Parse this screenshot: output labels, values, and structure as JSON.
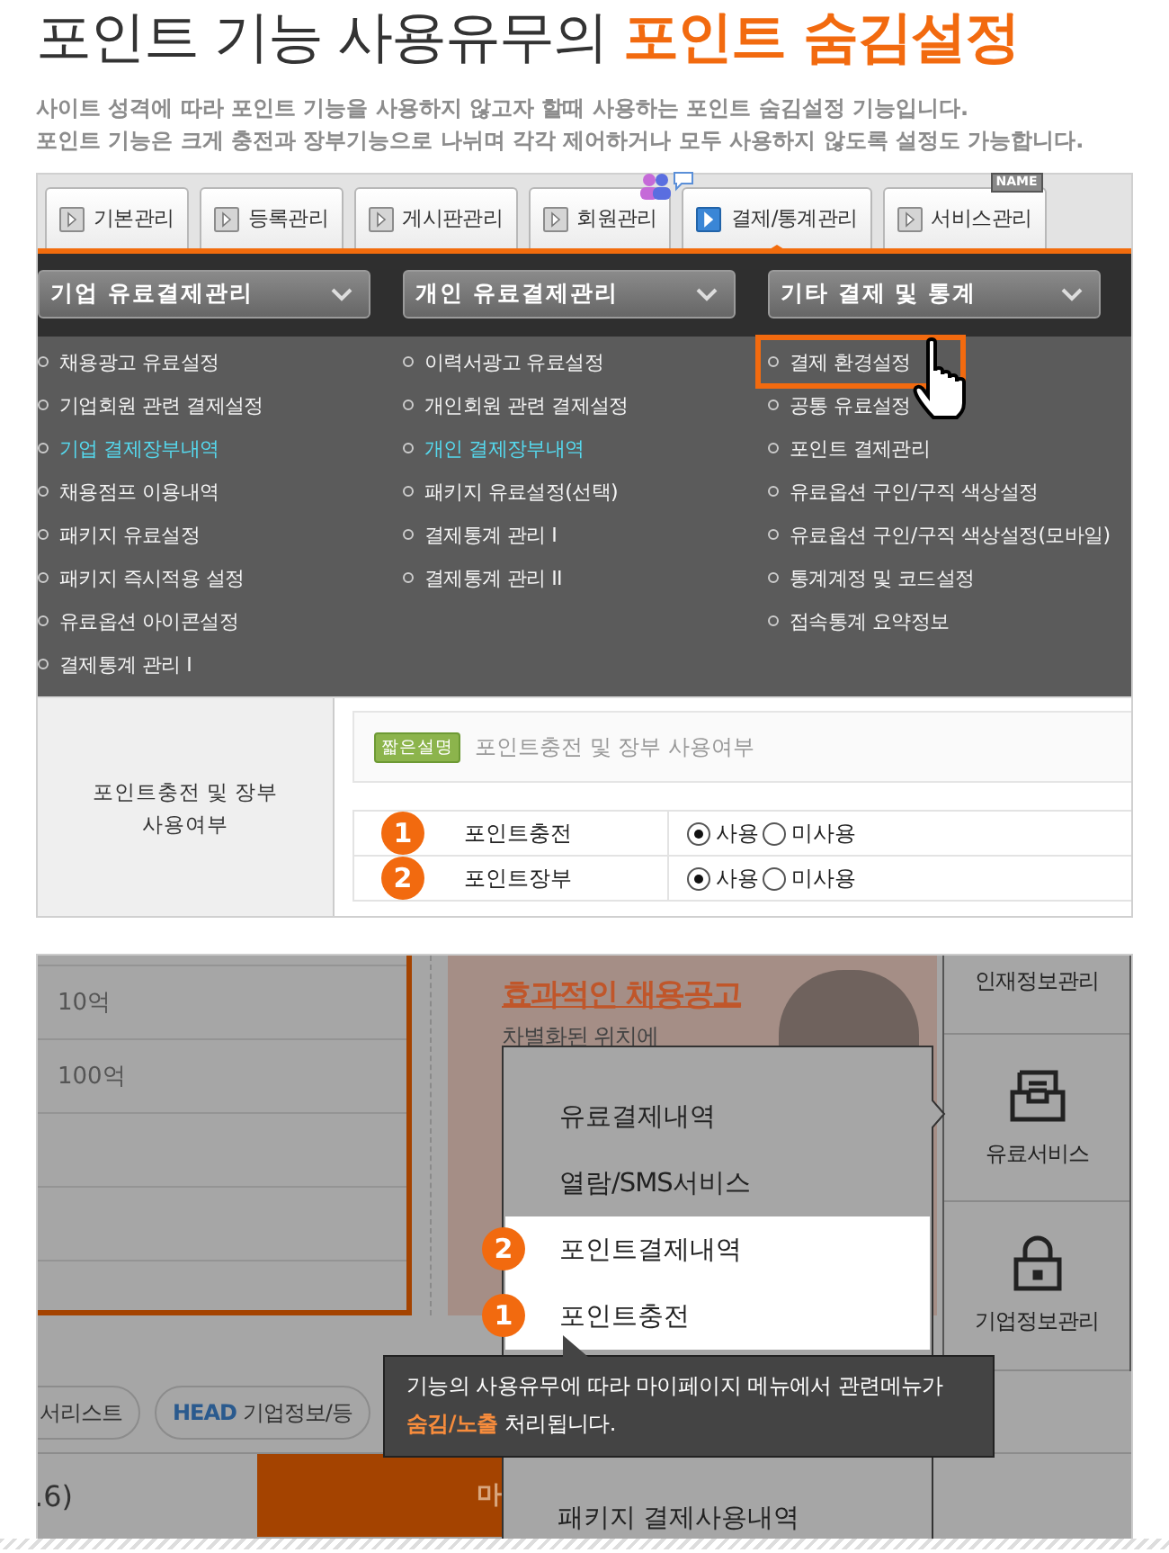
{
  "header": {
    "title": "포인트 기능 사용유무의 **포인트 숨김설정**",
    "description": [
      "사이트 성격에 따라 포인트 기능을 사용하지 않고자 할때 사용하는 포인트 숨김설정 기능입니다.",
      "포인트 기능은 크게 충전과 장부기능으로 나뉘며 각각 제어하거나 모두 사용하지 않도록 설정도 가능합니다."
    ]
  },
  "admin": {
    "tabs": [
      {
        "label": "기본관리",
        "selected": false
      },
      {
        "label": "등록관리",
        "selected": false
      },
      {
        "label": "게시판관리",
        "selected": false
      },
      {
        "label": "회원관리",
        "selected": false
      },
      {
        "label": "결제/통계관리",
        "selected": true
      },
      {
        "label": "서비스관리",
        "selected": false,
        "badge": "NAME"
      }
    ],
    "menu_columns": [
      {
        "title": "기업 유료결제관리",
        "items": [
          {
            "label": "채용광고 유료설정",
            "highlighted": false,
            "callout": false
          },
          {
            "label": "기업회원 관련 결제설정",
            "highlighted": false,
            "callout": false
          },
          {
            "label": "기업 결제장부내역",
            "highlighted": true,
            "callout": false
          },
          {
            "label": "채용점프 이용내역",
            "highlighted": false,
            "callout": false
          },
          {
            "label": "패키지 유료설정",
            "highlighted": false,
            "callout": false
          },
          {
            "label": "패키지 즉시적용 설정",
            "highlighted": false,
            "callout": false
          },
          {
            "label": "유료옵션 아이콘설정",
            "highlighted": false,
            "callout": false
          },
          {
            "label": "결제통계 관리 I",
            "highlighted": false,
            "callout": false
          }
        ]
      },
      {
        "title": "개인 유료결제관리",
        "items": [
          {
            "label": "이력서광고 유료설정",
            "highlighted": false,
            "callout": false
          },
          {
            "label": "개인회원 관련 결제설정",
            "highlighted": false,
            "callout": false
          },
          {
            "label": "개인 결제장부내역",
            "highlighted": true,
            "callout": false
          },
          {
            "label": "패키지 유료설정(선택)",
            "highlighted": false,
            "callout": false
          },
          {
            "label": "결제통계 관리 I",
            "highlighted": false,
            "callout": false
          },
          {
            "label": "결제통계 관리 II",
            "highlighted": false,
            "callout": false
          }
        ]
      },
      {
        "title": "기타 결제 및 통계",
        "items": [
          {
            "label": "결제 환경설정",
            "highlighted": false,
            "callout": true
          },
          {
            "label": "공통 유료설정",
            "highlighted": false,
            "callout": false
          },
          {
            "label": "포인트 결제관리",
            "highlighted": false,
            "callout": false
          },
          {
            "label": "유료옵션 구인/구직 색상설정",
            "highlighted": false,
            "callout": false
          },
          {
            "label": "유료옵션 구인/구직 색상설정(모바일)",
            "highlighted": false,
            "callout": false
          },
          {
            "label": "통계계정 및 코드설정",
            "highlighted": false,
            "callout": false
          },
          {
            "label": "접속통계 요약정보",
            "highlighted": false,
            "callout": false
          }
        ]
      }
    ],
    "setting": {
      "label": "포인트충전 및 장부 사용여부",
      "badge": "짧은설명",
      "summary": "포인트충전 및 장부 사용여부",
      "rows": [
        {
          "number": "1",
          "label": "포인트충전",
          "options": [
            {
              "label": "사용",
              "selected": true
            },
            {
              "label": "미사용",
              "selected": false
            }
          ]
        },
        {
          "number": "2",
          "label": "포인트장부",
          "options": [
            {
              "label": "사용",
              "selected": true
            },
            {
              "label": "미사용",
              "selected": false
            }
          ]
        }
      ]
    }
  },
  "mypage": {
    "list_rows": [
      "10억",
      "100억"
    ],
    "banner": {
      "title": "효과적인 채용공고",
      "subtitle": "차별화된 위치에"
    },
    "sidebar": [
      "인재정보관리",
      "유료서비스",
      "기업정보관리"
    ],
    "pills": [
      "서리스트",
      "**HEAD** 기업정보/등"
    ],
    "bottom_cells": [
      ".6)",
      "마"
    ],
    "popup": {
      "items": [
        {
          "label": "유료결제내역",
          "highlighted": false
        },
        {
          "label": "열람/SMS서비스",
          "highlighted": false
        },
        {
          "label": "포인트결제내역",
          "highlighted": true,
          "number": "2"
        },
        {
          "label": "포인트충전",
          "highlighted": true,
          "number": "1"
        }
      ],
      "last_item": "패키지 결제사용내역"
    },
    "tooltip": "기능의 사용유무에 따라 마이페이지 메뉴에서 관련메뉴가\n**숨김/노출** 처리됩니다."
  }
}
